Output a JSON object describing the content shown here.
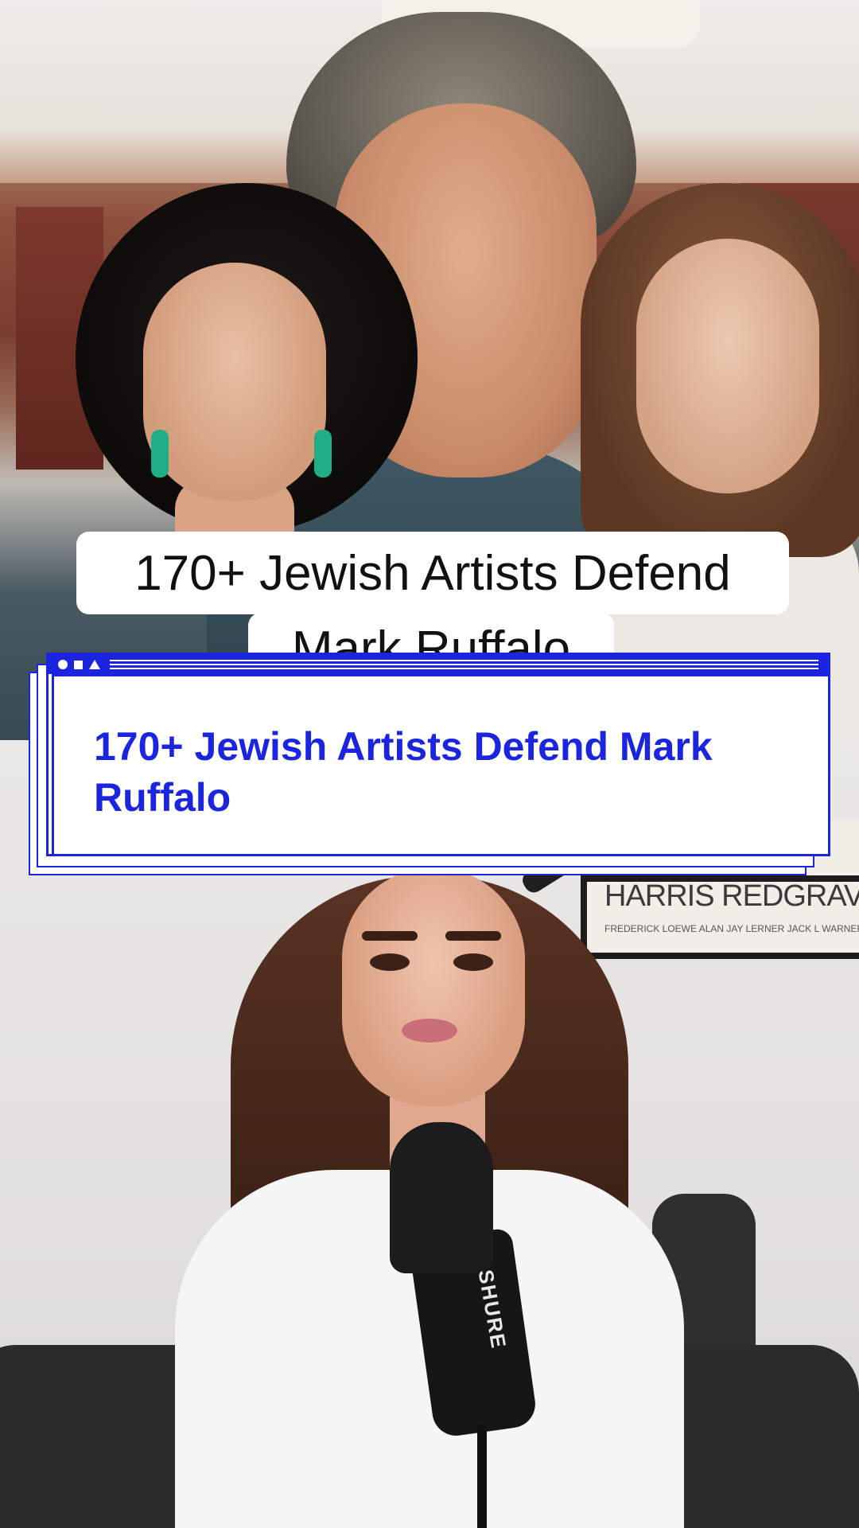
{
  "video_caption": {
    "line1": "170+ Jewish Artists Defend",
    "line2": "Mark Ruffalo"
  },
  "title_card": {
    "title": "170+ Jewish Artists Defend Mark Ruffalo",
    "accent_color": "#1b25e0",
    "titlebar_icons": [
      "circle-icon",
      "square-icon",
      "triangle-icon"
    ]
  },
  "poster": {
    "names": "HARRIS REDGRAVE NERO HEMMING",
    "credits": "FREDERICK LOEWE ALAN JAY LERNER JACK L WARNER JOSHUA LOGAN TECHNI"
  },
  "microphone": {
    "brand": "SHURE"
  }
}
